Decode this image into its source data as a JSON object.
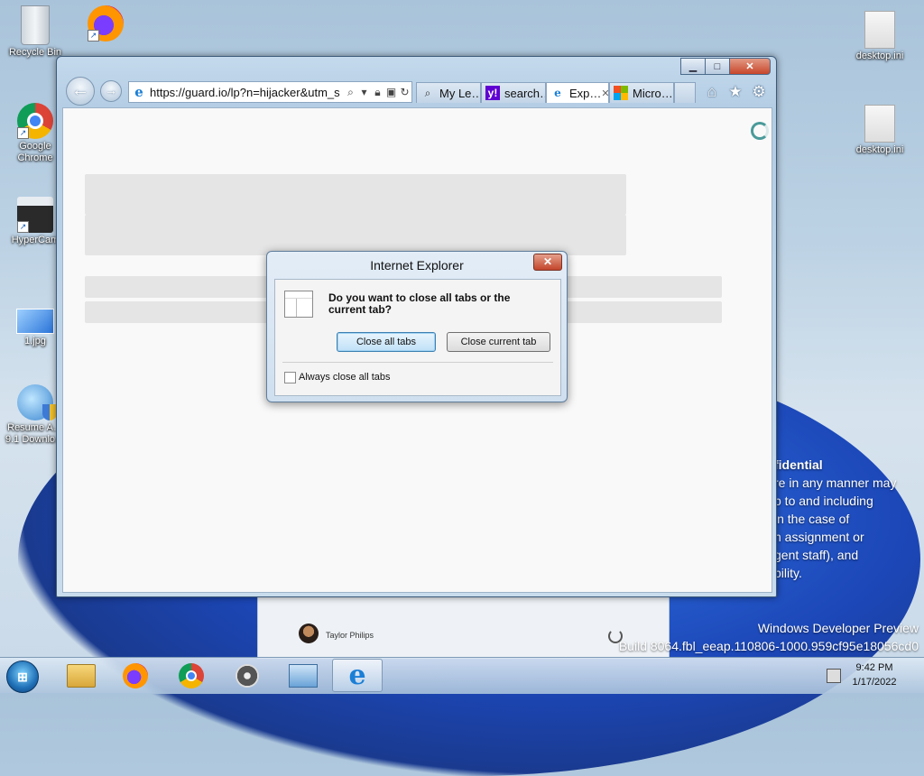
{
  "desktop": {
    "icons": [
      {
        "label": "Recycle Bin",
        "icon": "recycle-bin-icon"
      },
      {
        "label": "Google Chrome",
        "icon": "chrome-icon"
      },
      {
        "label": "HyperCam",
        "icon": "hypercam-icon"
      },
      {
        "label": "1.jpg",
        "icon": "image-file-icon"
      },
      {
        "label": "Resume A… 9.1 Downlo…",
        "icon": "installer-icon"
      },
      {
        "label": "Firefox",
        "icon": "firefox-icon"
      },
      {
        "label": "desktop.ini",
        "icon": "settings-file-icon"
      },
      {
        "label": "desktop.ini",
        "icon": "settings-file-icon"
      }
    ],
    "watermark_title": "fidential",
    "watermark_lines": [
      "re in any manner may",
      "p to and including",
      "in the case of",
      "n assignment or",
      "gent staff), and",
      "bility."
    ],
    "dev_preview": "Windows Developer Preview",
    "build": "Build 8064.fbl_eeap.110806-1000.959cf95e18056cd0"
  },
  "start_fragment": {
    "user_name": "Taylor Philips"
  },
  "browser": {
    "address": "https://guard.io/lp?n=hijacker&utm_s",
    "tabs": [
      {
        "label": "My Le…",
        "icon": "search-icon",
        "active": false
      },
      {
        "label": "search…",
        "icon": "yahoo-icon",
        "active": false
      },
      {
        "label": "Exp…",
        "icon": "ie-icon",
        "active": true
      },
      {
        "label": "Micro…",
        "icon": "microsoft-icon",
        "active": false
      }
    ],
    "toolbar_icons": [
      "home-icon",
      "favorites-star-icon",
      "gear-icon"
    ]
  },
  "dialog": {
    "title": "Internet Explorer",
    "message": "Do you want to close all tabs or the current tab?",
    "close_all_label": "Close all tabs",
    "close_current_label": "Close current tab",
    "checkbox_label": "Always close all tabs",
    "checkbox_checked": false
  },
  "taskbar": {
    "time": "9:42 PM",
    "date": "1/17/2022"
  },
  "colors": {
    "accent": "#3c7fb1",
    "close_red": "#c7462a"
  }
}
